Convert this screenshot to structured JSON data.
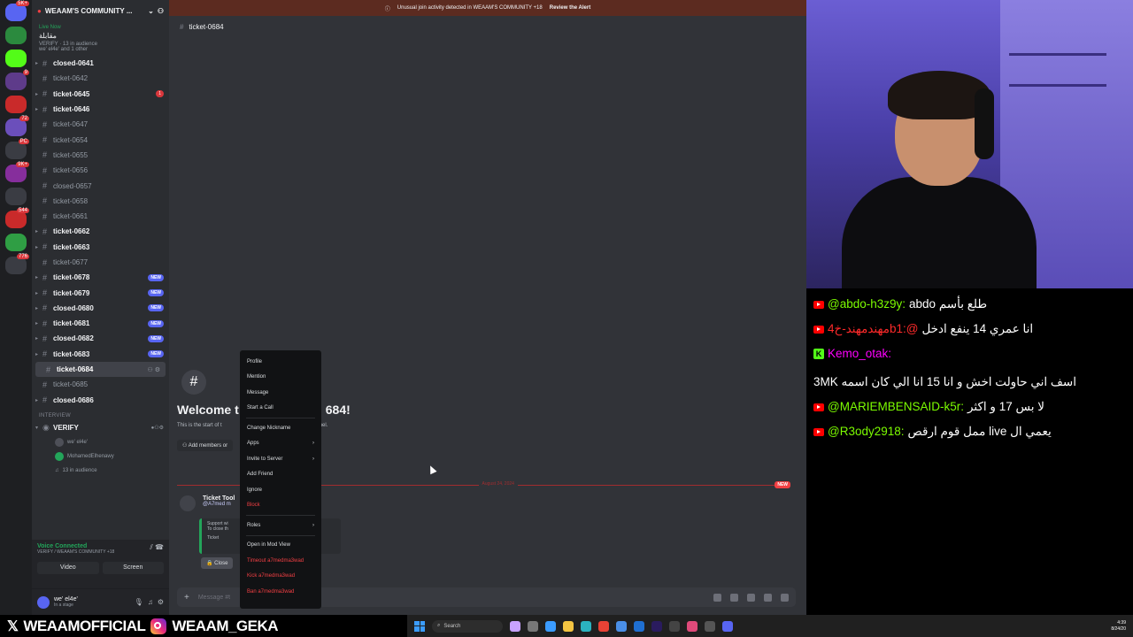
{
  "alert": {
    "text": "Unusual join activity detected in WEAAM'S COMMUNITY +18",
    "action": "Review the Alert"
  },
  "server": {
    "name": "WEAAM'S COMMUNITY ...",
    "live_label": "Live Now",
    "stage_name": "مقابلة",
    "stage_info": "VERIFY · 13 in audience",
    "stage_users": "we' el4e' and 1 other"
  },
  "rail": {
    "badges": [
      "5K+",
      "",
      "",
      "9",
      "",
      "72",
      "PC",
      "9K+",
      "",
      "544",
      "",
      "776"
    ]
  },
  "channels": [
    {
      "name": "closed-0641",
      "unread": true,
      "caret": true
    },
    {
      "name": "ticket-0642",
      "unread": false
    },
    {
      "name": "ticket-0645",
      "unread": true,
      "caret": true,
      "count": "1"
    },
    {
      "name": "ticket-0646",
      "unread": true,
      "caret": true
    },
    {
      "name": "ticket-0647",
      "unread": false
    },
    {
      "name": "ticket-0654",
      "unread": false
    },
    {
      "name": "ticket-0655",
      "unread": false
    },
    {
      "name": "ticket-0656",
      "unread": false
    },
    {
      "name": "closed-0657",
      "unread": false
    },
    {
      "name": "ticket-0658",
      "unread": false
    },
    {
      "name": "ticket-0661",
      "unread": false
    },
    {
      "name": "ticket-0662",
      "unread": true,
      "caret": true
    },
    {
      "name": "ticket-0663",
      "unread": true,
      "caret": true
    },
    {
      "name": "ticket-0677",
      "unread": false
    },
    {
      "name": "ticket-0678",
      "unread": true,
      "caret": true,
      "new": "NEW"
    },
    {
      "name": "ticket-0679",
      "unread": true,
      "caret": true,
      "new": "NEW"
    },
    {
      "name": "closed-0680",
      "unread": true,
      "caret": true,
      "new": "NEW"
    },
    {
      "name": "ticket-0681",
      "unread": true,
      "caret": true,
      "new": "NEW"
    },
    {
      "name": "closed-0682",
      "unread": true,
      "caret": true,
      "new": "NEW"
    },
    {
      "name": "ticket-0683",
      "unread": true,
      "caret": true,
      "new": "NEW"
    },
    {
      "name": "ticket-0684",
      "unread": true,
      "active": true
    },
    {
      "name": "ticket-0685",
      "unread": false
    },
    {
      "name": "closed-0686",
      "unread": true,
      "caret": true
    }
  ],
  "category": "INTERVIEW",
  "voice_channel": {
    "name": "VERIFY",
    "members": [
      "we' el4e'",
      "MohamedElhenawy"
    ],
    "audience": "13 in audience"
  },
  "voice_panel": {
    "status": "Voice Connected",
    "location": "VERIFY / WEAAM'S COMMUNITY +18",
    "video": "Video",
    "screen": "Screen"
  },
  "user": {
    "name": "we' el4e'",
    "status": "In a stage"
  },
  "chat_header": "ticket-0684",
  "welcome": {
    "title_left": "Welcome t",
    "title_right": "684!",
    "sub": "This is the start of t",
    "sub_right": "hannel.",
    "add_members": "Add members or",
    "date": "August 24, 2024",
    "new": "NEW"
  },
  "bot_message": {
    "name": "Ticket Tool",
    "mention": "@A7med m",
    "embed_line1": "Support wi",
    "embed_line2": "To close th",
    "embed_line3": "Ticket",
    "close": "Close"
  },
  "composer": {
    "placeholder": "Message #t"
  },
  "context_menu": {
    "items": [
      {
        "label": "Profile"
      },
      {
        "label": "Mention"
      },
      {
        "label": "Message"
      },
      {
        "label": "Start a Call"
      },
      {
        "sep": true
      },
      {
        "label": "Change Nickname"
      },
      {
        "label": "Apps",
        "sub": true
      },
      {
        "label": "Invite to Server",
        "sub": true
      },
      {
        "label": "Add Friend"
      },
      {
        "label": "Ignore"
      },
      {
        "label": "Block",
        "danger": true
      },
      {
        "sep": true
      },
      {
        "label": "Roles",
        "sub": true
      },
      {
        "sep": true
      },
      {
        "label": "Open in Mod View"
      },
      {
        "label": "Timeout a7medma3wad",
        "danger": true
      },
      {
        "label": "Kick a7medma3wad",
        "danger": true
      },
      {
        "label": "Ban a7medma3wad",
        "danger": true
      }
    ]
  },
  "stream_chat": [
    {
      "platform": "youtube",
      "user": "@abdo-h3z9y:",
      "user_color": "#7CFC00",
      "text": "طلع بأسم abdo"
    },
    {
      "platform": "youtube",
      "user": "مهندمهند-خ4b1:@",
      "user_color": "#FF2A2A",
      "text": "انا عمري 14 ينفع ادخل"
    },
    {
      "platform": "kick",
      "user": "Kemo_otak:",
      "user_color": "#FF00FF",
      "text": "اسف اني حاولت اخش و انا 15 انا الي كان اسمه 3MK"
    },
    {
      "platform": "youtube",
      "user": "@MARIEMBENSAID-k5r:",
      "user_color": "#7CFC00",
      "text": "لا بس 17 و اكثر"
    },
    {
      "platform": "youtube",
      "user": "@R3ody2918:",
      "user_color": "#7CFC00",
      "text": "يعمي ال live ممل قوم ارقص"
    }
  ],
  "social": {
    "x_handle": "WEAAMOFFICIAL",
    "ig_handle": "WEAAM_GEKA"
  },
  "taskbar": {
    "search": "Search",
    "time": "4:39",
    "date": "8/24/20"
  },
  "colors": {
    "accent": "#5865f2",
    "danger": "#f23f43",
    "online": "#23a55a"
  }
}
